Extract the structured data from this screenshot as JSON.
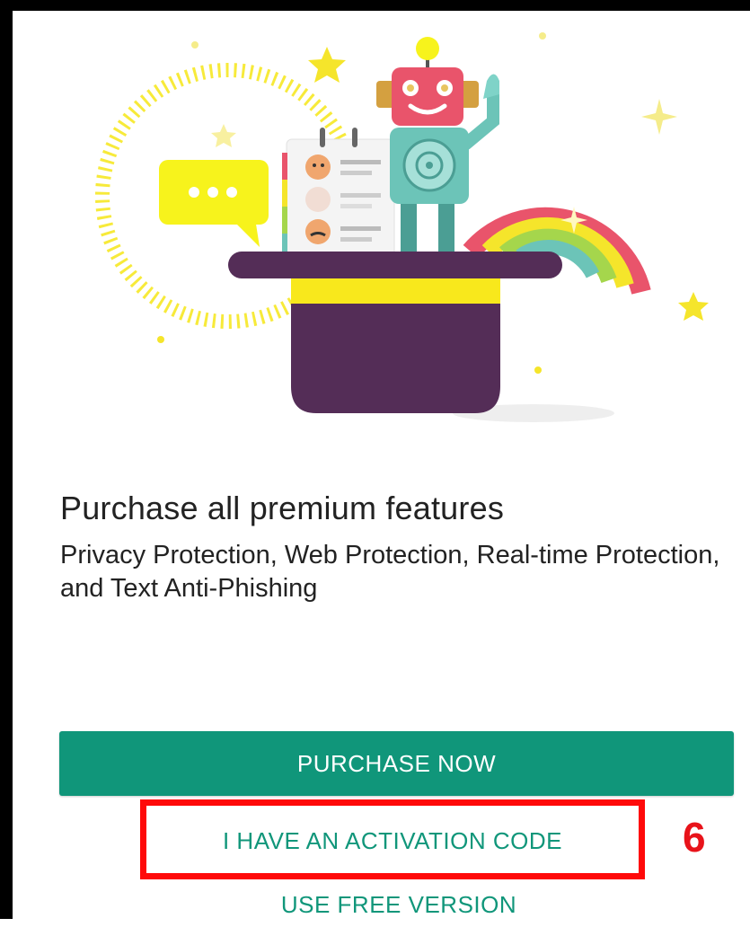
{
  "promo": {
    "title": "Purchase all premium features",
    "subtitle": "Privacy Protection, Web Protection, Real-time Protection, and Text Anti-Phishing"
  },
  "actions": {
    "purchase_label": "PURCHASE NOW",
    "activation_label": "I HAVE AN ACTIVATION CODE",
    "free_label": "USE FREE VERSION"
  },
  "annotation": {
    "step_number": "6"
  },
  "colors": {
    "accent": "#10967a",
    "highlight": "#ff0a0a",
    "hat": "#542d57",
    "hat_band": "#f8e81c",
    "robot_head": "#e9546b",
    "robot_body": "#6cc4b8"
  },
  "icons": {
    "hero": "magic-hat-robot-illustration"
  }
}
